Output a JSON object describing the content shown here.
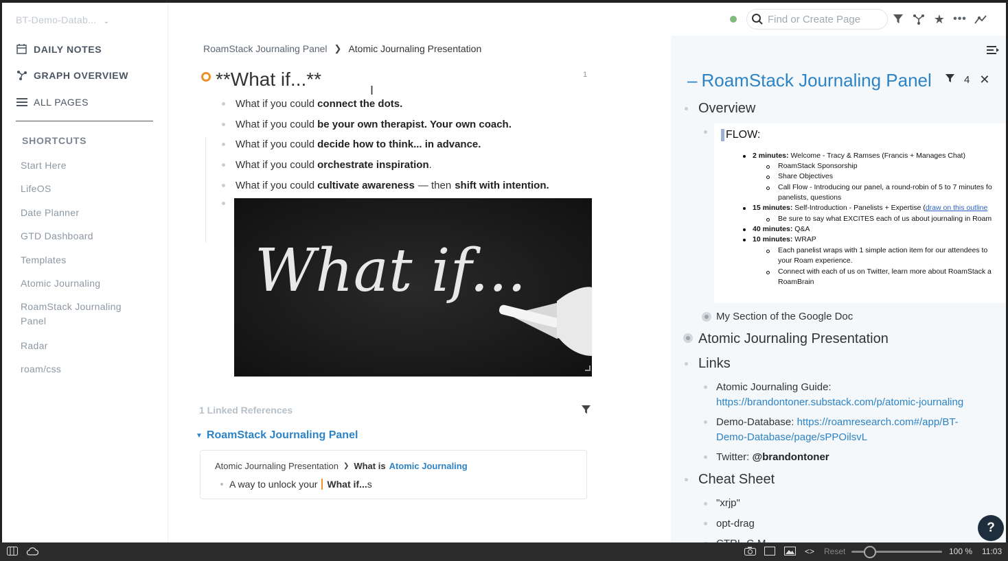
{
  "sidebar": {
    "database": "BT-Demo-Datab...",
    "nav": [
      {
        "label": "DAILY NOTES",
        "icon": "calendar-icon"
      },
      {
        "label": "GRAPH OVERVIEW",
        "icon": "graph-icon"
      },
      {
        "label": "ALL PAGES",
        "icon": "list-icon"
      }
    ],
    "shortcuts_title": "SHORTCUTS",
    "shortcuts": [
      "Start Here",
      "LifeOS",
      "Date Planner",
      "GTD Dashboard",
      "Templates",
      "Atomic Journaling",
      "RoamStack Journaling Panel",
      "Radar",
      "roam/css"
    ]
  },
  "topbar": {
    "search_placeholder": "Find or Create Page",
    "icons": [
      "filter-icon",
      "graph-icon",
      "star-icon",
      "more-icon",
      "settings-icon"
    ]
  },
  "main": {
    "breadcrumb": [
      "RoamStack Journaling Panel",
      "Atomic Journaling Presentation"
    ],
    "title": "**What if...**",
    "ref_count": "1",
    "bullets": [
      {
        "prefix": "What if you could",
        "bold": "connect the dots.",
        "mid": "",
        "bold2": ""
      },
      {
        "prefix": "What if you could",
        "bold": "be your own therapist. Your own coach.",
        "mid": "",
        "bold2": ""
      },
      {
        "prefix": "What if you could",
        "bold": "decide how to think... in advance.",
        "mid": "",
        "bold2": ""
      },
      {
        "prefix": "What if you could",
        "bold": "orchestrate inspiration",
        "mid": ".",
        "bold2": ""
      },
      {
        "prefix": "What if you could",
        "bold": "cultivate awareness",
        "mid": "— then",
        "bold2": "shift with intention."
      }
    ],
    "image_text": "What if...",
    "linked_refs": {
      "title": "1 Linked References",
      "page": "RoamStack Journaling Panel",
      "crumb_1": "Atomic Journaling Presentation",
      "crumb_2": "What is",
      "crumb_link": "Atomic Journaling",
      "text": "A way to unlock your",
      "text_bold": "What if...",
      "text_tail": "s"
    }
  },
  "right_panel": {
    "title": "RoamStack Journaling Panel",
    "filter_count": "4",
    "overview": "Overview",
    "flow": {
      "heading": "FLOW:",
      "lines": [
        {
          "b": "2 minutes:",
          "t": "Welcome - Tracy & Ramses  (Francis + Manages Chat)"
        },
        {
          "b": "",
          "t": "RoamStack Sponsorship"
        },
        {
          "b": "",
          "t": "Share Objectives"
        },
        {
          "b": "",
          "t": "Call Flow - Introducing our panel, a round-robin of 5 to 7 minutes fo"
        },
        {
          "b": "",
          "t": "panelists, questions"
        },
        {
          "b": "15 minutes:",
          "t": "Self-Introduction - Panelists + Expertise ("
        },
        {
          "b": "",
          "t": "draw on this outline"
        },
        {
          "b": "",
          "t": "Be sure to say what EXCITES each of us about journaling in Roam"
        },
        {
          "b": "40 minutes:",
          "t": "Q&A"
        },
        {
          "b": "10 minutes:",
          "t": "WRAP"
        },
        {
          "b": "",
          "t": "Each panelist wraps with 1 simple action item for our attendees to"
        },
        {
          "b": "",
          "t": "your Roam experience."
        },
        {
          "b": "",
          "t": "Connect with each of us on Twitter, learn more about RoamStack a"
        },
        {
          "b": "",
          "t": "RoamBrain"
        }
      ]
    },
    "google_doc": "My Section of the Google Doc",
    "presentation": "Atomic Journaling Presentation",
    "links_title": "Links",
    "links": {
      "guide_label": "Atomic Journaling Guide:",
      "guide_url": "https://brandontoner.substack.com/p/atomic-journaling",
      "demo_label": "Demo-Database:",
      "demo_url_1": "https://roamresearch.com#/app/BT-",
      "demo_url_2": "Demo-Database/page/sPPOilsvL",
      "twitter_label": "Twitter:",
      "twitter_handle": "@brandontoner"
    },
    "cheat_title": "Cheat Sheet",
    "cheat": [
      "\"xrjp\"",
      "opt-drag",
      "CTRL-C-M"
    ]
  },
  "bottom_bar": {
    "reset": "Reset",
    "zoom": "100 %",
    "time": "11:03",
    "zoom_level": 0.15
  }
}
